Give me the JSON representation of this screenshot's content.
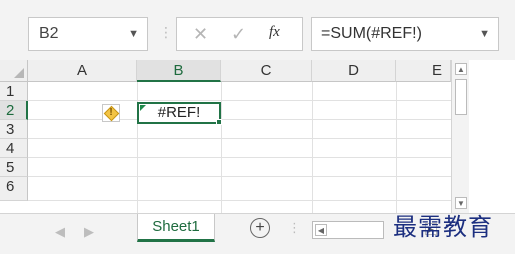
{
  "formula_bar": {
    "name_box": "B2",
    "cancel_icon": "close-icon",
    "enter_icon": "check-icon",
    "fx_label": "fx",
    "formula": "=SUM(#REF!)"
  },
  "grid": {
    "columns": [
      "A",
      "B",
      "C",
      "D",
      "E"
    ],
    "rows": [
      "1",
      "2",
      "3",
      "4",
      "5",
      "6"
    ],
    "selected_column": "B",
    "selected_row": "2",
    "active_cell_value": "#REF!"
  },
  "sheets": {
    "tabs": [
      "Sheet1"
    ],
    "add_label": "+"
  },
  "watermark": "最需教育",
  "colors": {
    "accent_green": "#217346",
    "error_warning": "#f3c445"
  }
}
